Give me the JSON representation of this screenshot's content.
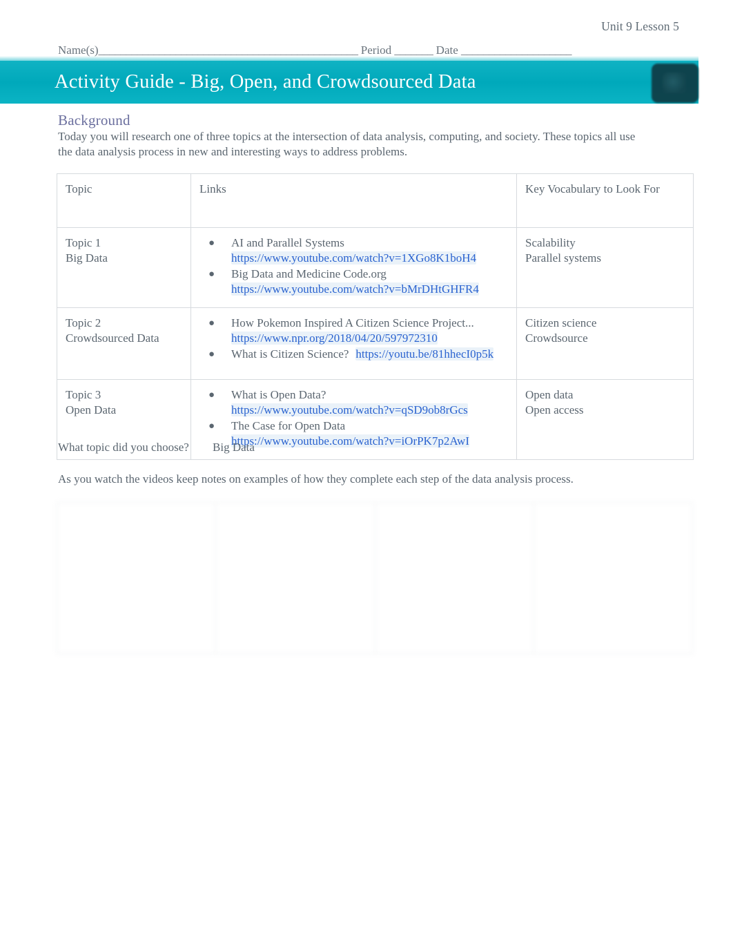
{
  "header": {
    "unit_lesson": "Unit 9 Lesson 5",
    "name_label": "Name(s)",
    "name_rule": "_______________________________________________",
    "period_label": "Period",
    "period_rule": "_______",
    "date_label": "Date",
    "date_rule": "____________________"
  },
  "banner": {
    "title": "Activity Guide - Big, Open, and Crowdsourced Data",
    "logo_name": "code-org-logo",
    "color": "#00a9bb"
  },
  "background": {
    "heading": "Background",
    "heading_color": "#6b6f9e",
    "paragraph": "Today you will research one of three topics at the intersection of data analysis, computing, and society. These topics all use the data analysis process in new and interesting ways to address problems."
  },
  "topics_table": {
    "headers": [
      "Topic",
      "Links",
      "Key Vocabulary to Look For"
    ],
    "rows": [
      {
        "topic_number": "Topic 1",
        "topic_name": "Big Data",
        "links": [
          {
            "title": "AI and Parallel Systems",
            "url": "https://www.youtube.com/watch?v=1XGo8K1boH4",
            "inline": false
          },
          {
            "title": "Big Data and Medicine Code.org",
            "url": "https://www.youtube.com/watch?v=bMrDHtGHFR4",
            "inline": false
          }
        ],
        "vocab": [
          "Scalability",
          "Parallel systems"
        ]
      },
      {
        "topic_number": "Topic 2",
        "topic_name": "Crowdsourced Data",
        "links": [
          {
            "title": "How Pokemon Inspired A Citizen Science Project...",
            "url": "https://www.npr.org/2018/04/20/597972310",
            "inline": false
          },
          {
            "title": "What is Citizen Science?",
            "url": "https://youtu.be/81hhecI0p5k",
            "inline": true
          }
        ],
        "vocab": [
          "Citizen science",
          "Crowdsource"
        ]
      },
      {
        "topic_number": "Topic 3",
        "topic_name": "Open Data",
        "links": [
          {
            "title": "What is Open Data?",
            "url": "https://www.youtube.com/watch?v=qSD9ob8rGcs",
            "inline": false
          },
          {
            "title": "The Case for Open Data",
            "url": "https://www.youtube.com/watch?v=iOrPK7p2AwI",
            "inline": false
          }
        ],
        "vocab": [
          "Open data",
          "Open access"
        ]
      }
    ],
    "link_color": "#2b63d0",
    "bullet_glyph": "●"
  },
  "choose": {
    "question": "What topic did you choose?",
    "answer": "Big Data"
  },
  "notes_intro": "As you watch the videos keep notes on examples of how they complete each step of the data analysis process.",
  "notes_table": {
    "columns": [
      {
        "heading": "",
        "body": ""
      },
      {
        "heading": "",
        "body": ""
      },
      {
        "heading": "",
        "body": ""
      },
      {
        "heading": "",
        "body": ""
      }
    ]
  },
  "lower": {
    "heading": "",
    "paragraph_1": "",
    "paragraph_2": "",
    "paragraph_3": ""
  },
  "footer": {
    "left": "",
    "right": ""
  }
}
